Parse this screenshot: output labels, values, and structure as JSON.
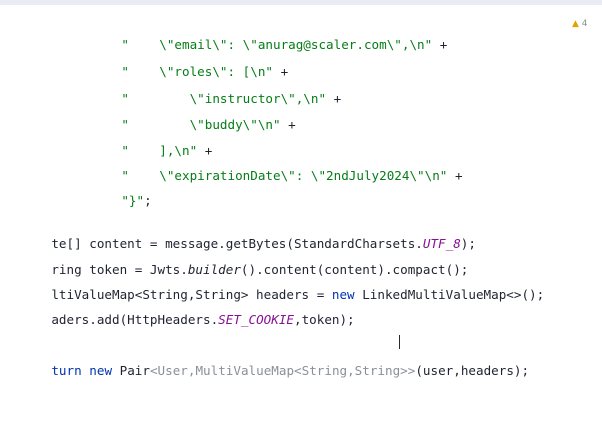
{
  "editor": {
    "lines": [
      {
        "indent": "    \"",
        "p1": "    \\\"email\\\": \\\"anurag@scaler.com\\\",\\n\"",
        "op": " +"
      },
      {
        "indent": "    \"",
        "p1": "    \\\"roles\\\": [\\n\"",
        "op": " +"
      },
      {
        "indent": "    \"",
        "p1": "        \\\"instructor\\\",\\n\"",
        "op": " +"
      },
      {
        "indent": "    \"",
        "p1": "        \\\"buddy\\\"\\n\"",
        "op": " +"
      },
      {
        "indent": "    \"",
        "p1": "    ],\\n\"",
        "op": " +"
      },
      {
        "indent": "    \"",
        "p1": "    \\\"expirationDate\\\": \\\"2ndJuly2024\\\"\\n\"",
        "op": " +"
      },
      {
        "indent": "    \"",
        "p1": "}\"",
        "op": ";"
      }
    ],
    "code": {
      "l1": {
        "a": "te[] content = message.getBytes(StandardCharsets.",
        "b": "UTF_8",
        "c": ");"
      },
      "l2": {
        "a": "ring token = Jwts.",
        "b": "builder",
        "c": "().content(content).compact();"
      },
      "l3": {
        "a": "ltiValueMap<String,String> headers = ",
        "k": "new",
        "c": " LinkedMultiValueMap<>();"
      },
      "l4": {
        "a": "aders.add(HttpHeaders.",
        "b": "SET_COOKIE",
        "c": ",token);"
      },
      "l5": {
        "k1": "turn",
        "k2": "new",
        "a": "Pair",
        "h": "<User,MultiValueMap<String,String>>",
        "c": "(user,headers);"
      }
    },
    "badge_warn": "▲",
    "badge_count": "4"
  }
}
